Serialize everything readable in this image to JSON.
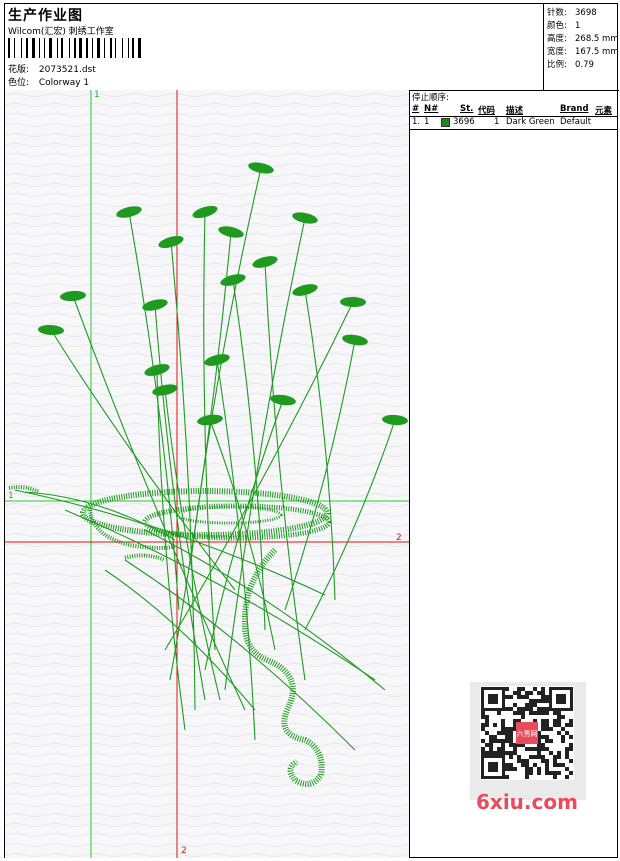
{
  "header": {
    "title": "生产作业图",
    "company": "Wilcom(汇宏) 刺绣工作室",
    "design_label": "花版:",
    "design_value": "2073521.dst",
    "colorway_label": "色位:",
    "colorway_value": "Colorway 1"
  },
  "stats": {
    "stitches_label": "针数:",
    "stitches_value": "3698",
    "colors_label": "颜色:",
    "colors_value": "1",
    "height_label": "高度:",
    "height_value": "268.5 mm",
    "width_label": "宽度:",
    "width_value": "167.5 mm",
    "scale_label": "比例:",
    "scale_value": "0.79"
  },
  "stop_sequence": {
    "title": "停止顺序:",
    "columns": {
      "num": "#",
      "n": "N#",
      "st": "St.",
      "code": "代码",
      "desc": "描述",
      "brand": "Brand",
      "element": "元素"
    },
    "rows": [
      {
        "num": "1.",
        "n": "1",
        "st": "3696",
        "code": "1",
        "desc": "Dark Green",
        "brand": "Default",
        "color": "#1a8a1a"
      }
    ]
  },
  "axes": {
    "y_top": "1",
    "x_left": "1",
    "x_right": "2",
    "y_bottom": "2"
  },
  "colors": {
    "thread": "#1f9a1f",
    "axis_green": "#22cc22",
    "axis_red": "#dd1111",
    "watermark": "#e84c5c"
  },
  "watermark": {
    "text": "6xiu.com",
    "qr_text": "六秀网"
  }
}
